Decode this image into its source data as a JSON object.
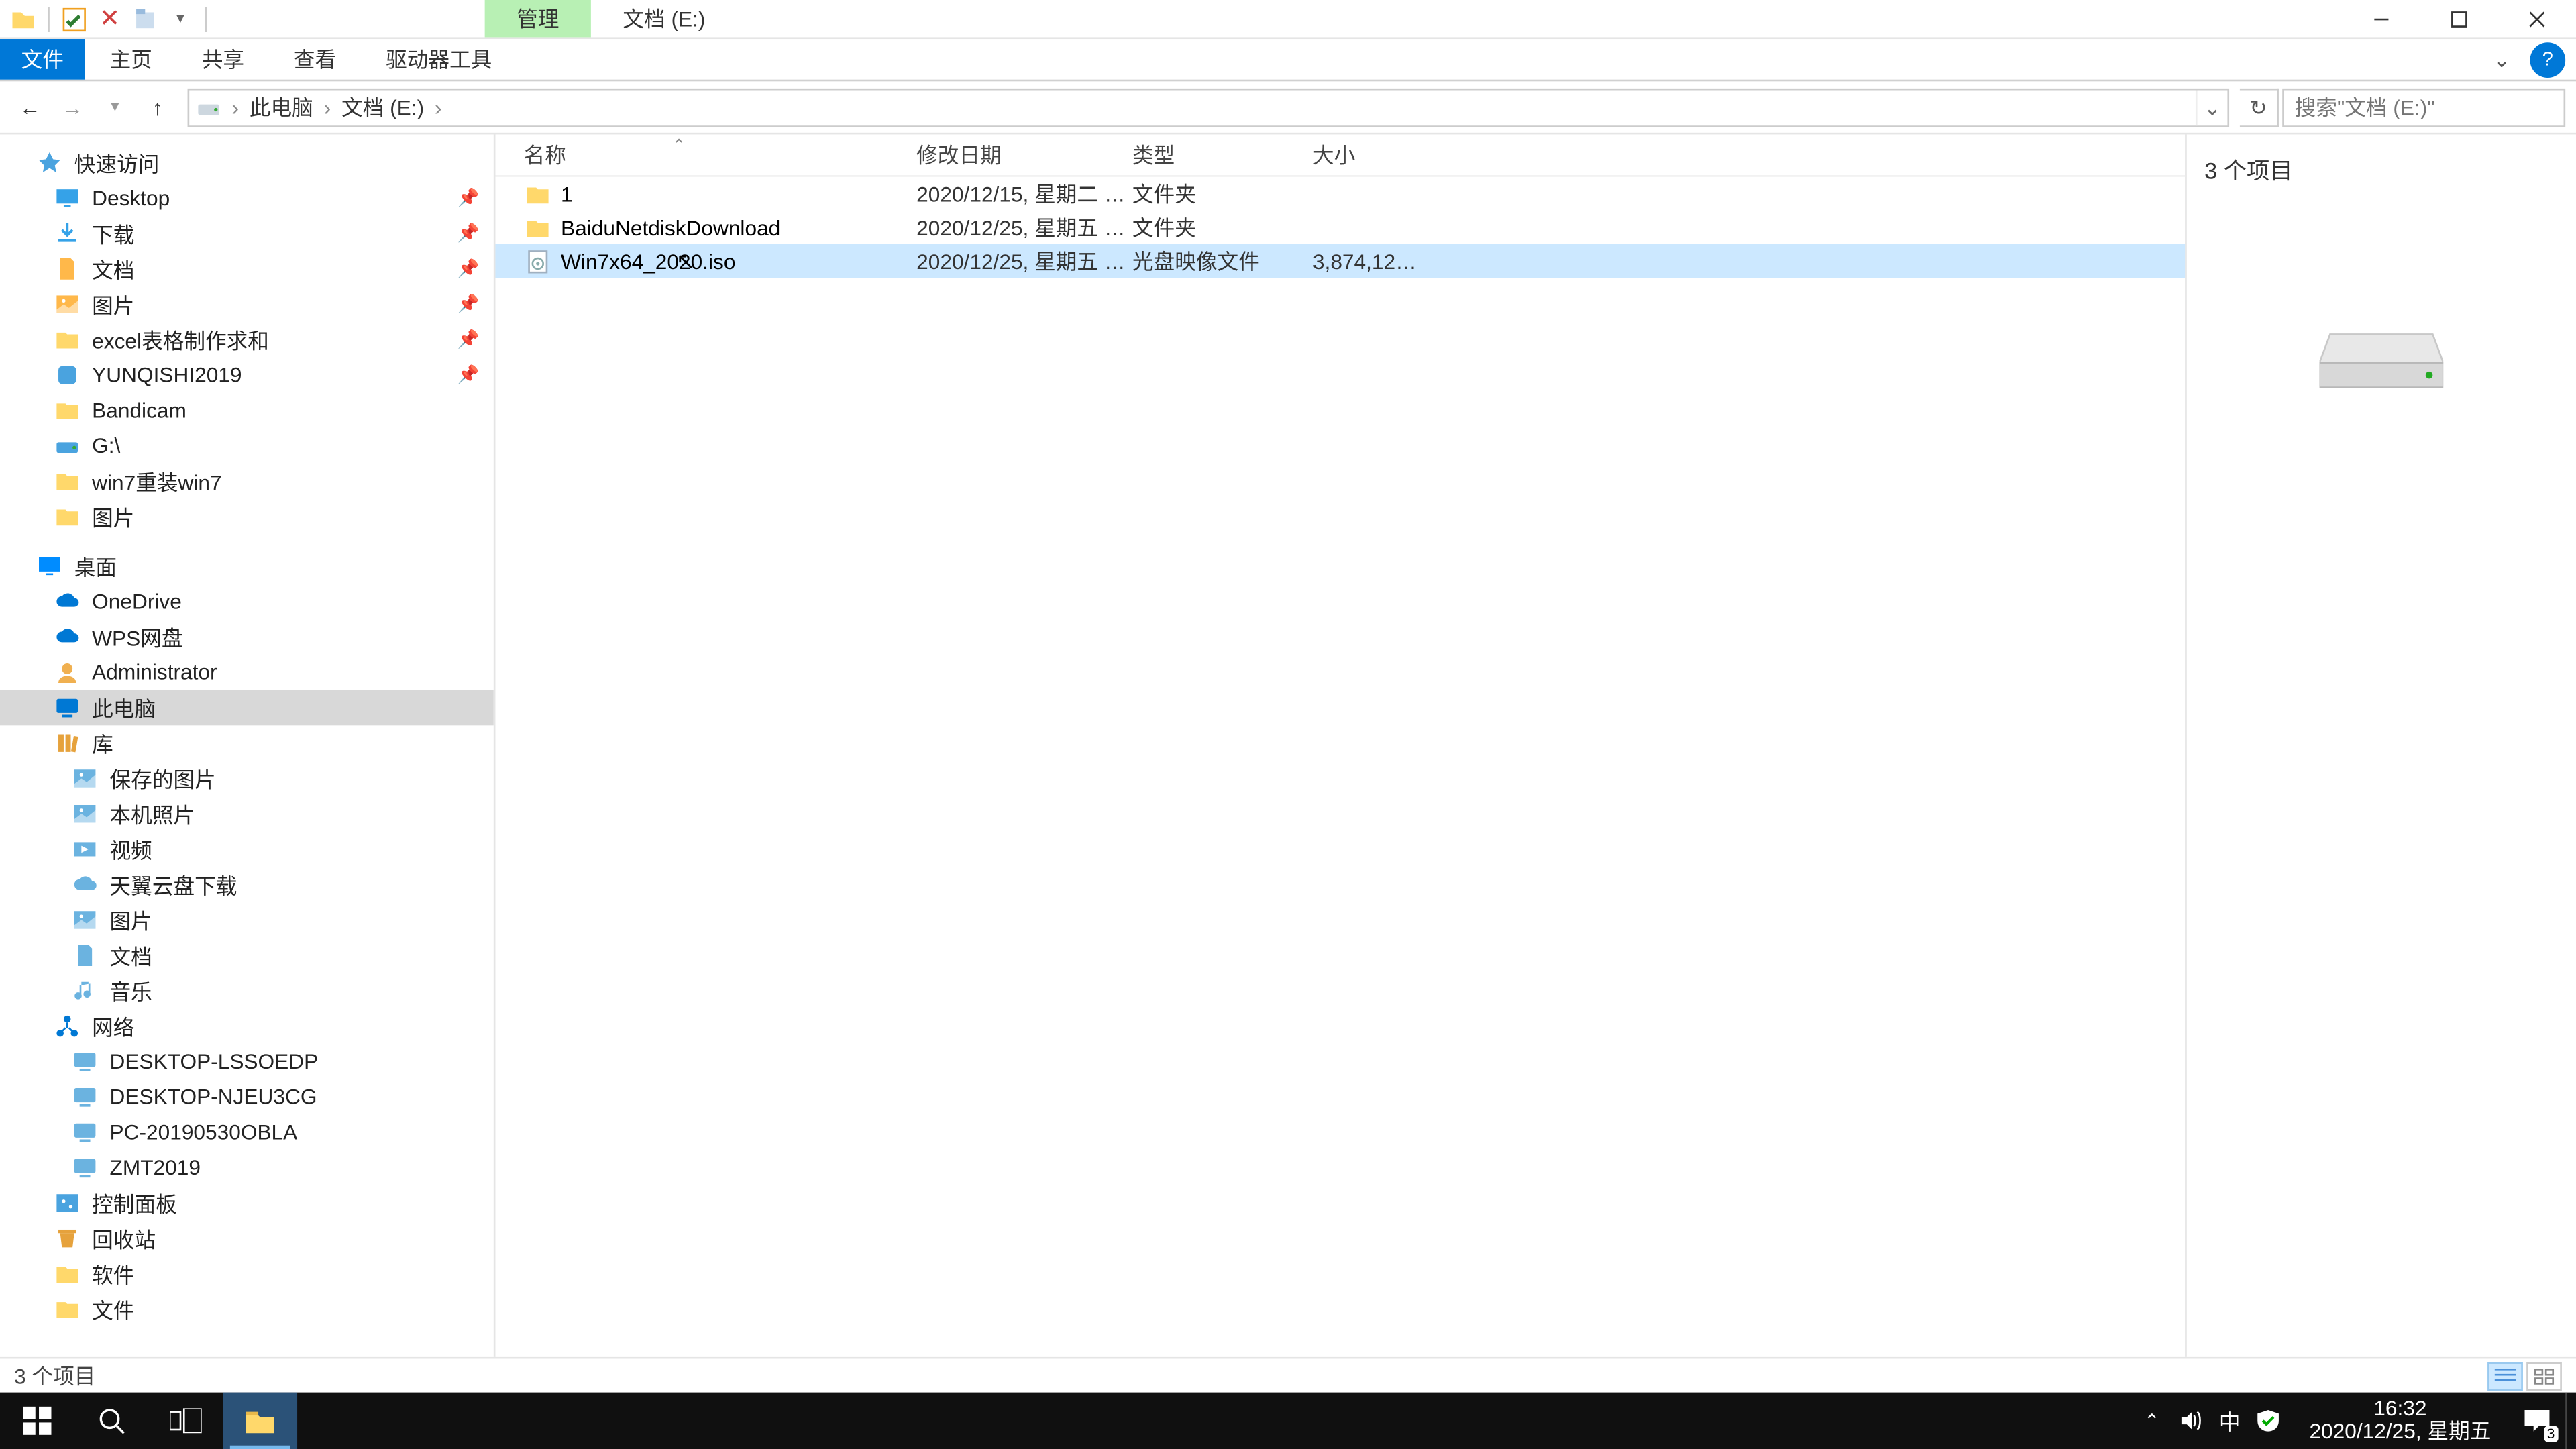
{
  "titlebar": {
    "context_tab": "管理",
    "location_tab": "文档 (E:)"
  },
  "ribbon": {
    "file": "文件",
    "home": "主页",
    "share": "共享",
    "view": "查看",
    "drive_tools": "驱动器工具"
  },
  "nav": {
    "breadcrumb": [
      "此电脑",
      "文档 (E:)"
    ],
    "search_placeholder": "搜索\"文档 (E:)\""
  },
  "tree": {
    "quick_access": {
      "label": "快速访问",
      "icon": "star-icon",
      "color": "#4aa3df"
    },
    "quick_items": [
      {
        "label": "Desktop",
        "icon": "desktop-icon",
        "color": "#35a2e8",
        "pinned": true
      },
      {
        "label": "下载",
        "icon": "download-icon",
        "color": "#35a2e8",
        "pinned": true
      },
      {
        "label": "文档",
        "icon": "document-icon",
        "color": "#ffb84a",
        "pinned": true
      },
      {
        "label": "图片",
        "icon": "picture-icon",
        "color": "#ffb84a",
        "pinned": true
      },
      {
        "label": "excel表格制作求和",
        "icon": "folder-icon",
        "color": "#ffd86b",
        "pinned": true
      },
      {
        "label": "YUNQISHI2019",
        "icon": "app-icon",
        "color": "#4aa3df",
        "pinned": true
      },
      {
        "label": "Bandicam",
        "icon": "folder-icon",
        "color": "#ffd86b",
        "pinned": false
      },
      {
        "label": "G:\\",
        "icon": "drive-icon",
        "color": "#4aa3df",
        "pinned": false
      },
      {
        "label": "win7重装win7",
        "icon": "folder-icon",
        "color": "#ffd86b",
        "pinned": false
      },
      {
        "label": "图片",
        "icon": "folder-icon",
        "color": "#ffd86b",
        "pinned": false
      }
    ],
    "desktop": {
      "label": "桌面",
      "icon": "desktop-icon",
      "color": "#008cff"
    },
    "desktop_items": [
      {
        "label": "OneDrive",
        "icon": "cloud-icon",
        "color": "#0078d4"
      },
      {
        "label": "WPS网盘",
        "icon": "cloud-icon",
        "color": "#0078d4"
      },
      {
        "label": "Administrator",
        "icon": "user-icon",
        "color": "#f0b050"
      },
      {
        "label": "此电脑",
        "icon": "pc-icon",
        "color": "#0078d4",
        "selected": true
      },
      {
        "label": "库",
        "icon": "library-icon",
        "color": "#e6a23c"
      }
    ],
    "library_items": [
      {
        "label": "保存的图片",
        "icon": "picture-icon",
        "color": "#6bb3e0"
      },
      {
        "label": "本机照片",
        "icon": "picture-icon",
        "color": "#6bb3e0"
      },
      {
        "label": "视频",
        "icon": "video-icon",
        "color": "#6bb3e0"
      },
      {
        "label": "天翼云盘下载",
        "icon": "cloud-icon",
        "color": "#6bb3e0"
      },
      {
        "label": "图片",
        "icon": "picture-icon",
        "color": "#6bb3e0"
      },
      {
        "label": "文档",
        "icon": "document-icon",
        "color": "#6bb3e0"
      },
      {
        "label": "音乐",
        "icon": "music-icon",
        "color": "#6bb3e0"
      }
    ],
    "network": {
      "label": "网络",
      "icon": "network-icon",
      "color": "#0078d4"
    },
    "network_items": [
      {
        "label": "DESKTOP-LSSOEDP",
        "icon": "pc-icon",
        "color": "#6bb3e0"
      },
      {
        "label": "DESKTOP-NJEU3CG",
        "icon": "pc-icon",
        "color": "#6bb3e0"
      },
      {
        "label": "PC-20190530OBLA",
        "icon": "pc-icon",
        "color": "#6bb3e0"
      },
      {
        "label": "ZMT2019",
        "icon": "pc-icon",
        "color": "#6bb3e0"
      }
    ],
    "tail_items": [
      {
        "label": "控制面板",
        "icon": "control-panel-icon",
        "color": "#4aa3df"
      },
      {
        "label": "回收站",
        "icon": "recycle-bin-icon",
        "color": "#e6a23c"
      },
      {
        "label": "软件",
        "icon": "folder-icon",
        "color": "#ffd86b"
      },
      {
        "label": "文件",
        "icon": "folder-icon",
        "color": "#ffd86b"
      }
    ]
  },
  "columns": {
    "name": "名称",
    "date": "修改日期",
    "type": "类型",
    "size": "大小"
  },
  "files": [
    {
      "name": "1",
      "date": "2020/12/15, 星期二 1...",
      "type": "文件夹",
      "size": "",
      "icon": "folder-icon"
    },
    {
      "name": "BaiduNetdiskDownload",
      "date": "2020/12/25, 星期五 1...",
      "type": "文件夹",
      "size": "",
      "icon": "folder-icon"
    },
    {
      "name": "Win7x64_2020.iso",
      "date": "2020/12/25, 星期五 1...",
      "type": "光盘映像文件",
      "size": "3,874,126...",
      "icon": "disc-image-icon",
      "selected": true
    }
  ],
  "preview": {
    "caption": "3 个项目"
  },
  "status": {
    "text": "3 个项目"
  },
  "taskbar": {
    "ime": "中",
    "time": "16:32",
    "date": "2020/12/25, 星期五",
    "notif_count": "3"
  }
}
